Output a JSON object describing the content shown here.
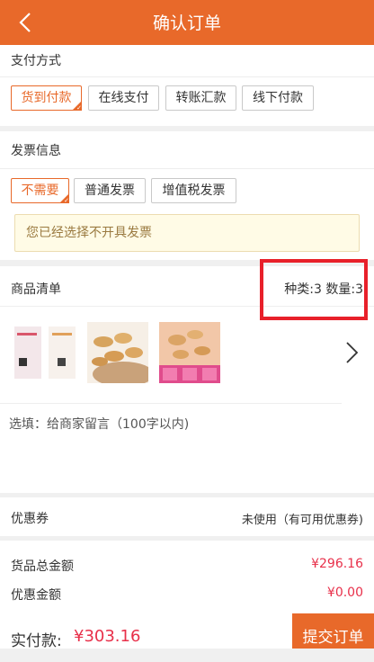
{
  "header": {
    "title": "确认订单"
  },
  "payment": {
    "title": "支付方式",
    "options": [
      "货到付款",
      "在线支付",
      "转账汇款",
      "线下付款"
    ],
    "selected": "货到付款"
  },
  "invoice": {
    "title": "发票信息",
    "options": [
      "不需要",
      "普通发票",
      "增值税发票"
    ],
    "selected": "不需要",
    "notice": "您已经选择不开具发票"
  },
  "goods": {
    "title": "商品清单",
    "summary": "种类:3 数量:3",
    "message_placeholder": "选填：给商家留言（100字以内)"
  },
  "coupon": {
    "label": "优惠券",
    "value": "未使用（有可用优惠券)"
  },
  "totals": {
    "goods_total_label": "货品总金额",
    "goods_total_value": "¥296.16",
    "discount_label": "优惠金额",
    "discount_value": "¥0.00"
  },
  "footer": {
    "paid_label": "实付款:",
    "paid_value": "¥303.16",
    "submit_label": "提交订单"
  },
  "colors": {
    "accent": "#e8692a",
    "price": "#e8304a",
    "highlight": "#e8202a"
  }
}
